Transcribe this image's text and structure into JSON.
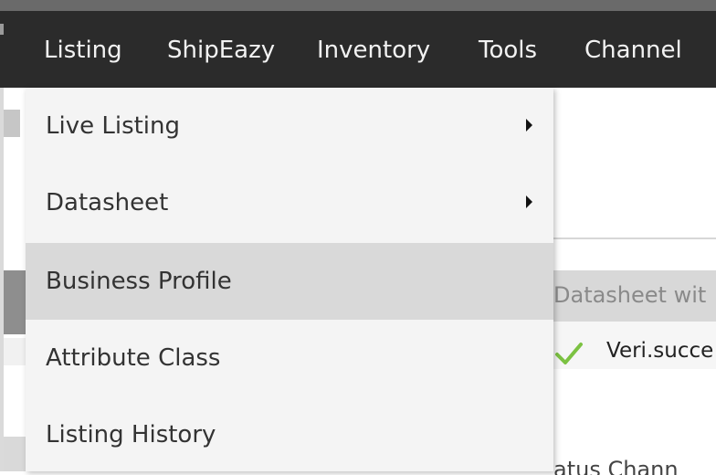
{
  "navbar": {
    "items": [
      {
        "label": "Listing"
      },
      {
        "label": "ShipEazy"
      },
      {
        "label": "Inventory"
      },
      {
        "label": "Tools"
      },
      {
        "label": "Channel"
      }
    ]
  },
  "dropdown": {
    "items": [
      {
        "label": "Live Listing",
        "has_submenu": true
      },
      {
        "label": "Datasheet",
        "has_submenu": true
      },
      {
        "label": "Business Profile",
        "active": true
      },
      {
        "label": "Attribute Class"
      },
      {
        "label": "Listing History"
      }
    ]
  },
  "background": {
    "table_header_text": "Datasheet wit",
    "success_text": "Veri.succe",
    "bottom_text": "atus   Chann"
  },
  "icons": {
    "submenu": "caret-right-icon",
    "success": "check-icon"
  },
  "colors": {
    "navbar_bg": "#2b2b2b",
    "menu_bg": "#f4f4f4",
    "menu_active_bg": "#d9d9d9",
    "success_check": "#7cc242"
  }
}
